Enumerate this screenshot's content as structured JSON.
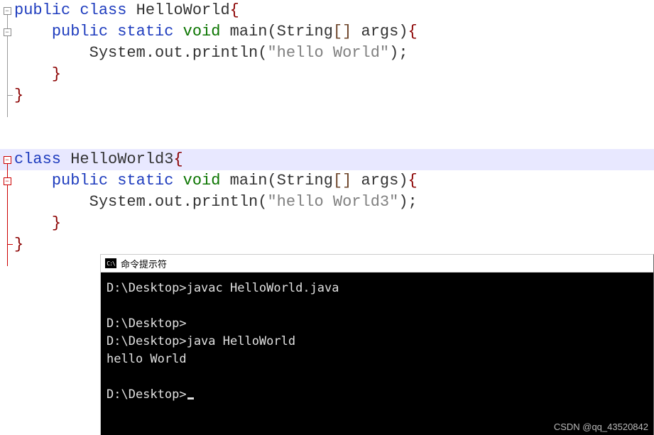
{
  "code": {
    "class1": {
      "decl_public": "public",
      "decl_class": "class",
      "name": "HelloWorld",
      "lbrace": "{",
      "main": {
        "public": "public",
        "static": "static",
        "void": "void",
        "name": "main",
        "lparen": "(",
        "type": "String",
        "lbracket": "[",
        "rbracket": "]",
        "param": "args",
        "rparen": ")",
        "lbrace": "{",
        "stmt": {
          "obj": "System.out.println",
          "lparen": "(",
          "str": "\"hello World\"",
          "rparen": ")",
          "semi": ";"
        },
        "rbrace": "}"
      },
      "rbrace": "}"
    },
    "class2": {
      "decl_class": "class",
      "name": "HelloWorld3",
      "lbrace": "{",
      "main": {
        "public": "public",
        "static": "static",
        "void": "void",
        "name": "main",
        "lparen": "(",
        "type": "String",
        "lbracket": "[",
        "rbracket": "]",
        "param": "args",
        "rparen": ")",
        "lbrace": "{",
        "stmt": {
          "obj": "System.out.println",
          "lparen": "(",
          "str": "\"hello World3\"",
          "rparen": ")",
          "semi": ";"
        },
        "rbrace": "}"
      },
      "rbrace": "}"
    }
  },
  "terminal": {
    "title": "命令提示符",
    "lines": {
      "l1": "D:\\Desktop>javac HelloWorld.java",
      "l2": "",
      "l3": "D:\\Desktop>",
      "l4": "D:\\Desktop>java HelloWorld",
      "l5": "hello World",
      "l6": "",
      "l7": "D:\\Desktop>"
    }
  },
  "watermark": "CSDN @qq_43520842"
}
